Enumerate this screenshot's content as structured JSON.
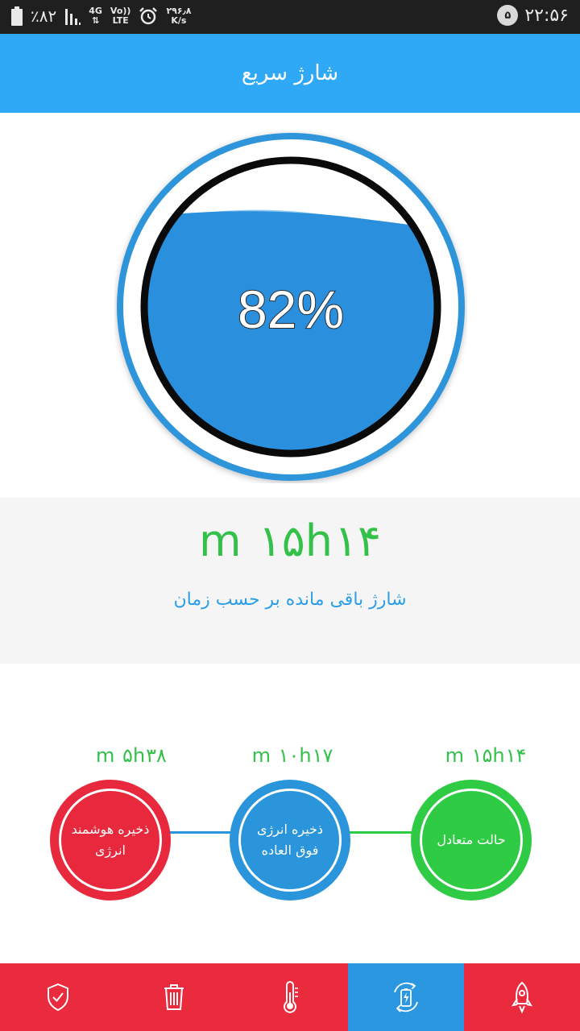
{
  "status_bar": {
    "battery_percent": "٪۸۲",
    "network_type": "4G",
    "volte_top": "Vo))",
    "volte_bottom": "LTE",
    "speed_value": "۲۹۶٫۸",
    "speed_unit": "K/s",
    "notification_count": "۵",
    "time": "۲۲:۵۶",
    "icons": [
      "battery-icon",
      "signal-icon",
      "data-arrows-icon",
      "alarm-icon"
    ]
  },
  "header": {
    "title": "شارژ سریع"
  },
  "gauge": {
    "percent_label": "82%",
    "level": 0.82,
    "fill_color": "#2a8fdc",
    "ring_color": "#2f95da"
  },
  "remaining": {
    "time": "m ۱۵h۱۴",
    "label": "شارژ باقی مانده بر حسب زمان"
  },
  "modes": [
    {
      "time": "m ۵h۳۸",
      "label": "ذخیره هوشمند انرژی",
      "color": "#e8283c"
    },
    {
      "time": "m ۱۰h۱۷",
      "label": "ذخیره انرژی فوق العاده",
      "color": "#2a95da"
    },
    {
      "time": "m ۱۵h۱۴",
      "label": "حالت متعادل",
      "color": "#2fcb45"
    }
  ],
  "bottom_nav": {
    "items": [
      {
        "icon": "shield-check-icon",
        "active": false
      },
      {
        "icon": "trash-icon",
        "active": false
      },
      {
        "icon": "thermometer-icon",
        "active": false
      },
      {
        "icon": "battery-charging-icon",
        "active": true
      },
      {
        "icon": "rocket-icon",
        "active": false
      }
    ],
    "colors": {
      "background": "#ea2a3d",
      "active": "#2a97e0"
    }
  }
}
